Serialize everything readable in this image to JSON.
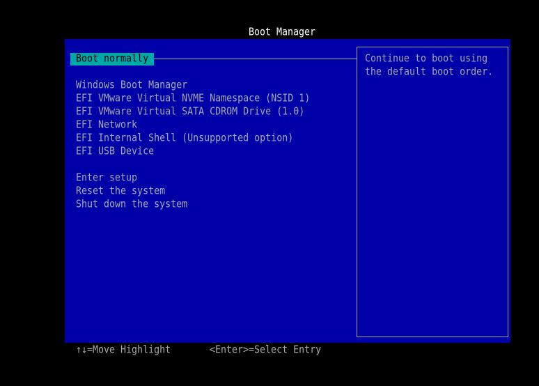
{
  "title": "Boot Manager",
  "selected": "Boot normally",
  "boot_items": [
    "Windows Boot Manager",
    "EFI VMware Virtual NVME Namespace (NSID 1)",
    "EFI VMware Virtual SATA CDROM Drive (1.0)",
    "EFI Network",
    "EFI Internal Shell (Unsupported option)",
    "EFI USB Device"
  ],
  "system_items": [
    "Enter setup",
    "Reset the system",
    "Shut down the system"
  ],
  "help": [
    "Continue to boot using",
    "the default boot order."
  ],
  "footer": {
    "move": "↑↓=Move Highlight",
    "select": "<Enter>=Select Entry"
  }
}
